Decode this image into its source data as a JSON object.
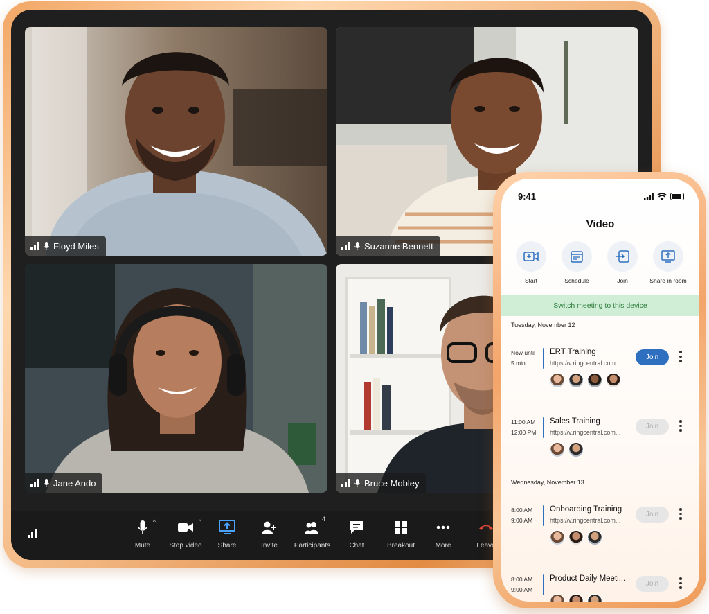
{
  "tablet": {
    "participants": [
      {
        "name": "Floyd Miles"
      },
      {
        "name": "Suzanne Bennett"
      },
      {
        "name": "Jane Ando"
      },
      {
        "name": "Bruce Mobley"
      }
    ],
    "toolbar": {
      "mute": "Mute",
      "stop_video": "Stop video",
      "share": "Share",
      "invite": "Invite",
      "participants": "Participants",
      "participants_count": "4",
      "chat": "Chat",
      "breakout": "Breakout",
      "more": "More",
      "leave": "Leave"
    },
    "colors": {
      "share_accent": "#4aa3ff",
      "leave_red": "#e0453a"
    }
  },
  "phone": {
    "time": "9:41",
    "title": "Video",
    "actions": {
      "start": "Start",
      "schedule": "Schedule",
      "join": "Join",
      "share_in_room": "Share in room"
    },
    "switch_banner": "Switch meeting to this device",
    "days": [
      {
        "label": "Tuesday, November 12",
        "meetings": [
          {
            "time1": "Now until",
            "time2": "5 min",
            "title": "ERT Training",
            "url": "https://v.ringcentral.com...",
            "join": "Join",
            "active": true
          },
          {
            "time1": "11:00 AM",
            "time2": "12:00 PM",
            "title": "Sales Training",
            "url": "https://v.ringcentral.com...",
            "join": "Join",
            "active": false
          }
        ]
      },
      {
        "label": "Wednesday, November 13",
        "meetings": [
          {
            "time1": "8:00 AM",
            "time2": "9:00 AM",
            "title": "Onboarding Training",
            "url": "https://v.ringcentral.com...",
            "join": "Join",
            "active": false
          },
          {
            "time1": "8:00 AM",
            "time2": "9:00 AM",
            "title": "Product Daily Meeti...",
            "url": "",
            "join": "Join",
            "active": false
          }
        ]
      }
    ],
    "colors": {
      "join_active": "#2f6fc0",
      "banner_bg": "#cfeed5",
      "banner_text": "#2e7d3e"
    }
  }
}
